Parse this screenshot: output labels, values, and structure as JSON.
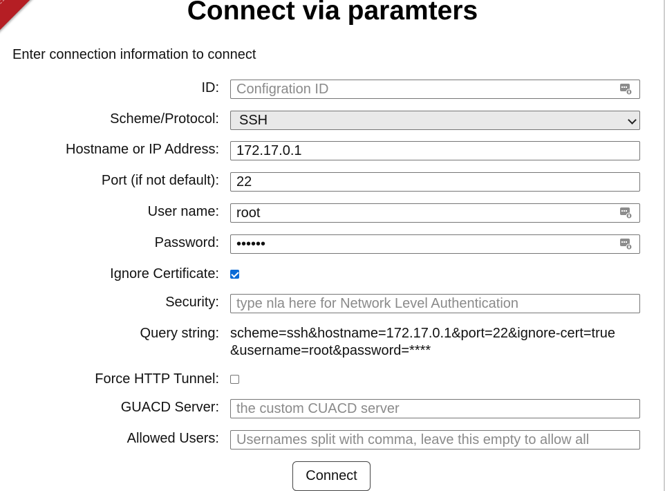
{
  "page": {
    "title": "Connect via paramters",
    "intro": "Enter connection information to connect"
  },
  "form": {
    "id": {
      "label": "ID:",
      "value": "",
      "placeholder": "Configration ID"
    },
    "scheme": {
      "label": "Scheme/Protocol:",
      "value": "SSH"
    },
    "hostname": {
      "label": "Hostname or IP Address:",
      "value": "172.17.0.1"
    },
    "port": {
      "label": "Port (if not default):",
      "value": "22"
    },
    "username": {
      "label": "User name:",
      "value": "root"
    },
    "password": {
      "label": "Password:",
      "value": "••••••"
    },
    "ignore_cert": {
      "label": "Ignore Certificate:",
      "checked": true
    },
    "security": {
      "label": "Security:",
      "value": "",
      "placeholder": "type nla here for Network Level Authentication"
    },
    "query": {
      "label": "Query string:",
      "value": "scheme=ssh&hostname=172.17.0.1&port=22&ignore-cert=true&username=root&password=****"
    },
    "force_http_tunnel": {
      "label": "Force HTTP Tunnel:",
      "checked": false
    },
    "guacd_server": {
      "label": "GUACD Server:",
      "value": "",
      "placeholder": "the custom CUACD server"
    },
    "allowed_users": {
      "label": "Allowed Users:",
      "value": "",
      "placeholder": "Usernames split with comma, leave this empty to allow all"
    },
    "connect_label": "Connect"
  },
  "colors": {
    "accent_checkbox": "#0b6bd6",
    "ribbon": "#b51e24"
  },
  "icons": {
    "keyboard": "password-manager-key-icon",
    "corner": "corner-ribbon"
  }
}
